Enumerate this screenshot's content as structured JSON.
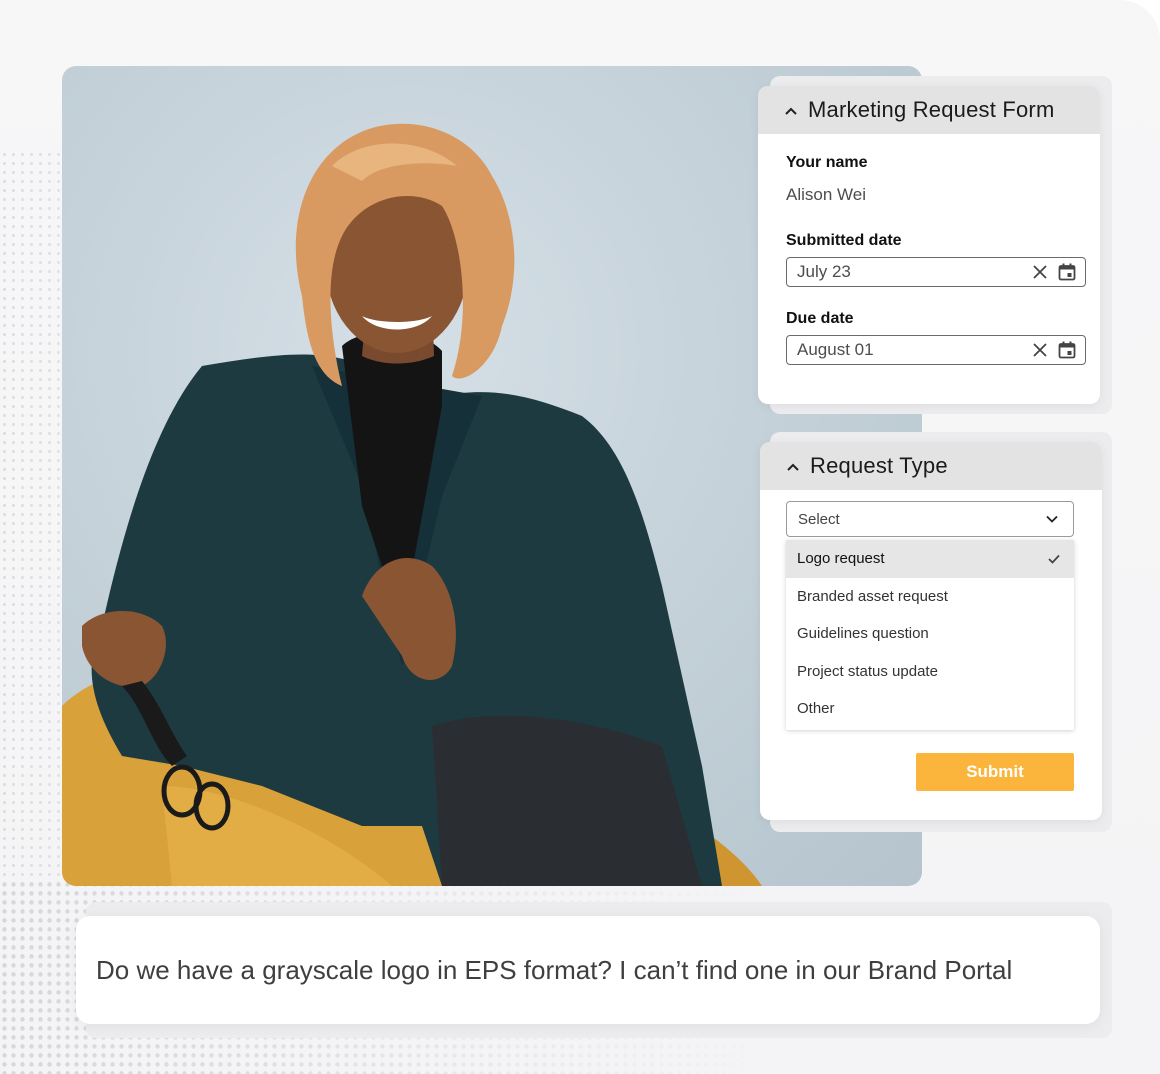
{
  "marketing_form": {
    "title": "Marketing Request Form",
    "your_name_label": "Your name",
    "your_name_value": "Alison Wei",
    "submitted_date_label": "Submitted date",
    "submitted_date_value": "July 23",
    "due_date_label": "Due date",
    "due_date_value": "August 01"
  },
  "request_type": {
    "title": "Request Type",
    "select_value": "Select",
    "options": [
      {
        "label": "Logo request",
        "selected": true
      },
      {
        "label": "Branded asset request",
        "selected": false
      },
      {
        "label": "Guidelines question",
        "selected": false
      },
      {
        "label": "Project status update",
        "selected": false
      },
      {
        "label": "Other",
        "selected": false
      }
    ],
    "submit_label": "Submit"
  },
  "chat": {
    "message": "Do we have a grayscale logo in EPS format? I can’t find one in our Brand Portal"
  },
  "icons": {
    "collapse": "chevron-up-icon",
    "clear": "close-icon",
    "calendar": "calendar-icon",
    "dropdown": "chevron-down-icon",
    "selected": "check-icon"
  },
  "colors": {
    "accent": "#fbb53c",
    "header_bg": "#e3e3e3"
  }
}
